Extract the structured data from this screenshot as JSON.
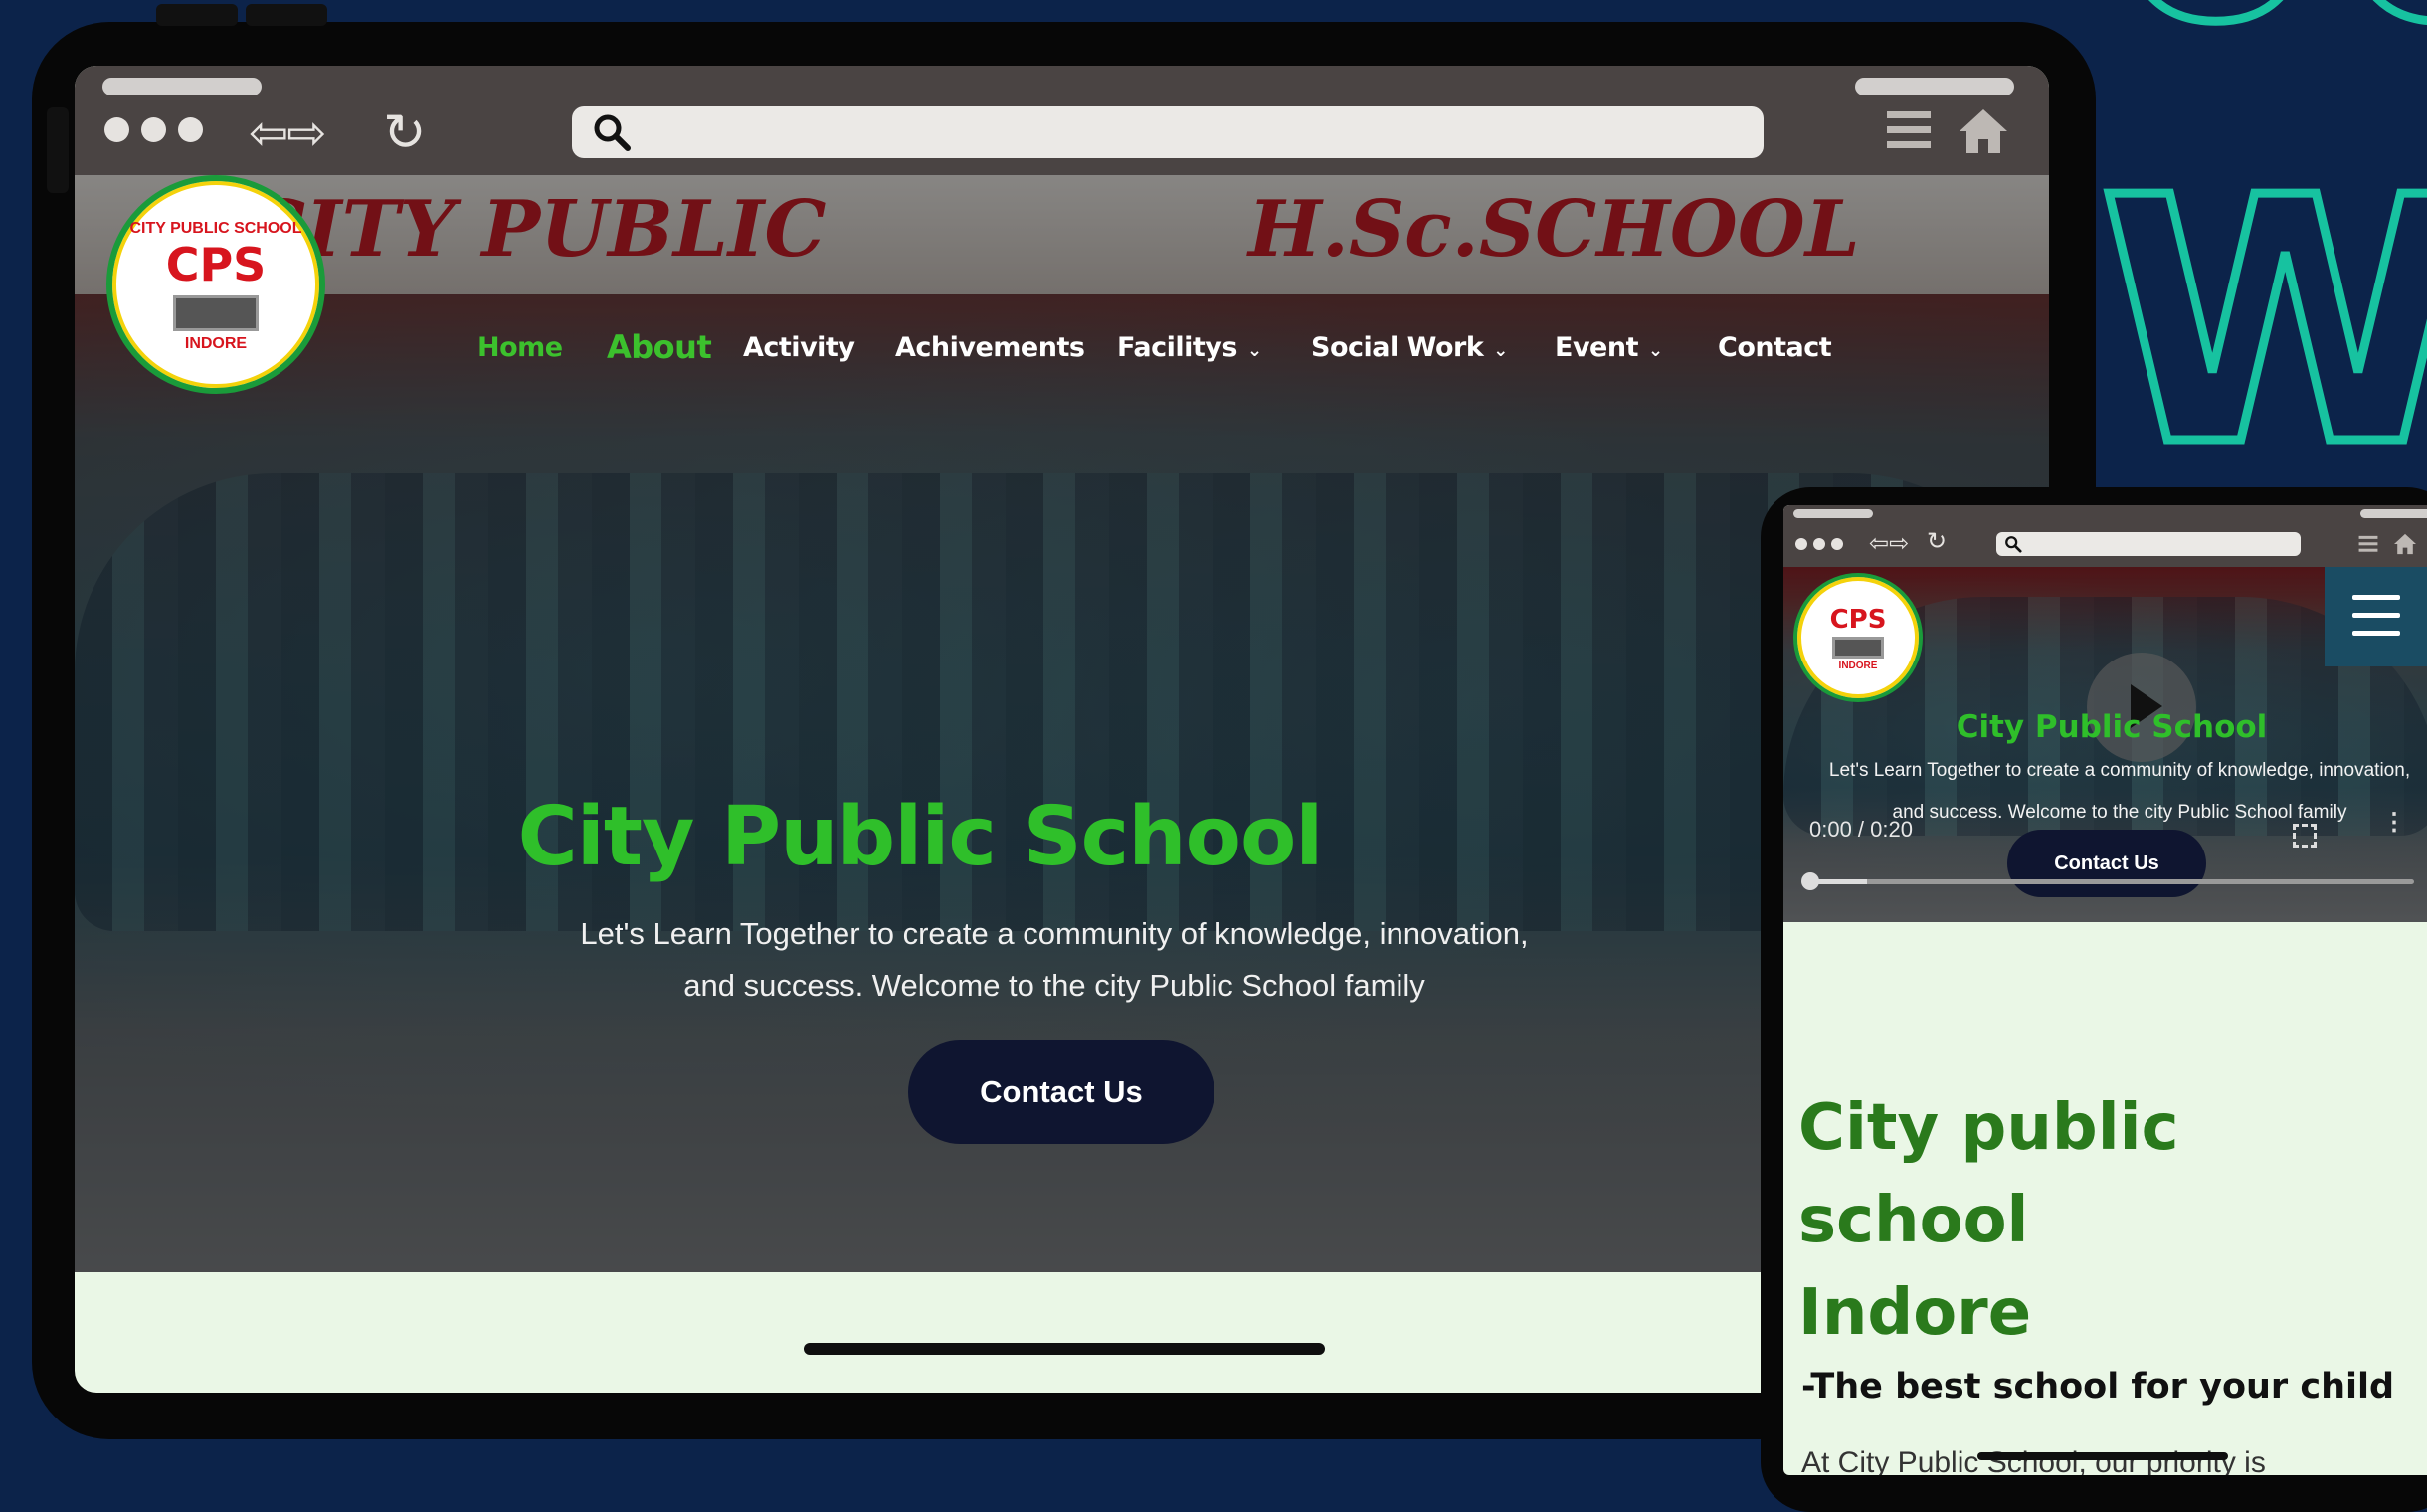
{
  "brand": {
    "accent": "#2fbf2a",
    "nav_active": "#3cc12d",
    "button_bg": "#0f1530",
    "page_bg": "#0c234a",
    "deco": "#17c2a0"
  },
  "decor": {
    "big_letters": "W"
  },
  "tablet": {
    "school_sign_left": "CITY PUBLIC",
    "school_sign_right": "H.Sc.SCHOOL",
    "logo": {
      "top": "CITY PUBLIC SCHOOL",
      "center": "CPS",
      "bottom": "INDORE"
    },
    "nav": [
      {
        "label": "Home",
        "active": true
      },
      {
        "label": "About",
        "active": true
      },
      {
        "label": "Activity"
      },
      {
        "label": "Achivements"
      },
      {
        "label": "Facilitys",
        "dropdown": true
      },
      {
        "label": "Social Work",
        "dropdown": true
      },
      {
        "label": "Event",
        "dropdown": true
      },
      {
        "label": "Contact"
      }
    ],
    "hero_title": "City Public School",
    "hero_sub_1": "Let's Learn Together to create a community of knowledge, innovation,",
    "hero_sub_2": "and success. Welcome to the city Public School family",
    "cta": "Contact Us"
  },
  "phone": {
    "hero_title": "City Public School",
    "hero_sub_1": "Let's Learn Together to create a community of knowledge, innovation,",
    "hero_sub_2": "and success. Welcome to the city Public School family",
    "video_time": "0:00 / 0:20",
    "video_progress": 0.0,
    "cta": "Contact Us",
    "heading_1": "City public",
    "heading_2": "school",
    "heading_3": "Indore",
    "tagline": "-The best school for your child",
    "para_start": "At City Public School, our priority is"
  }
}
